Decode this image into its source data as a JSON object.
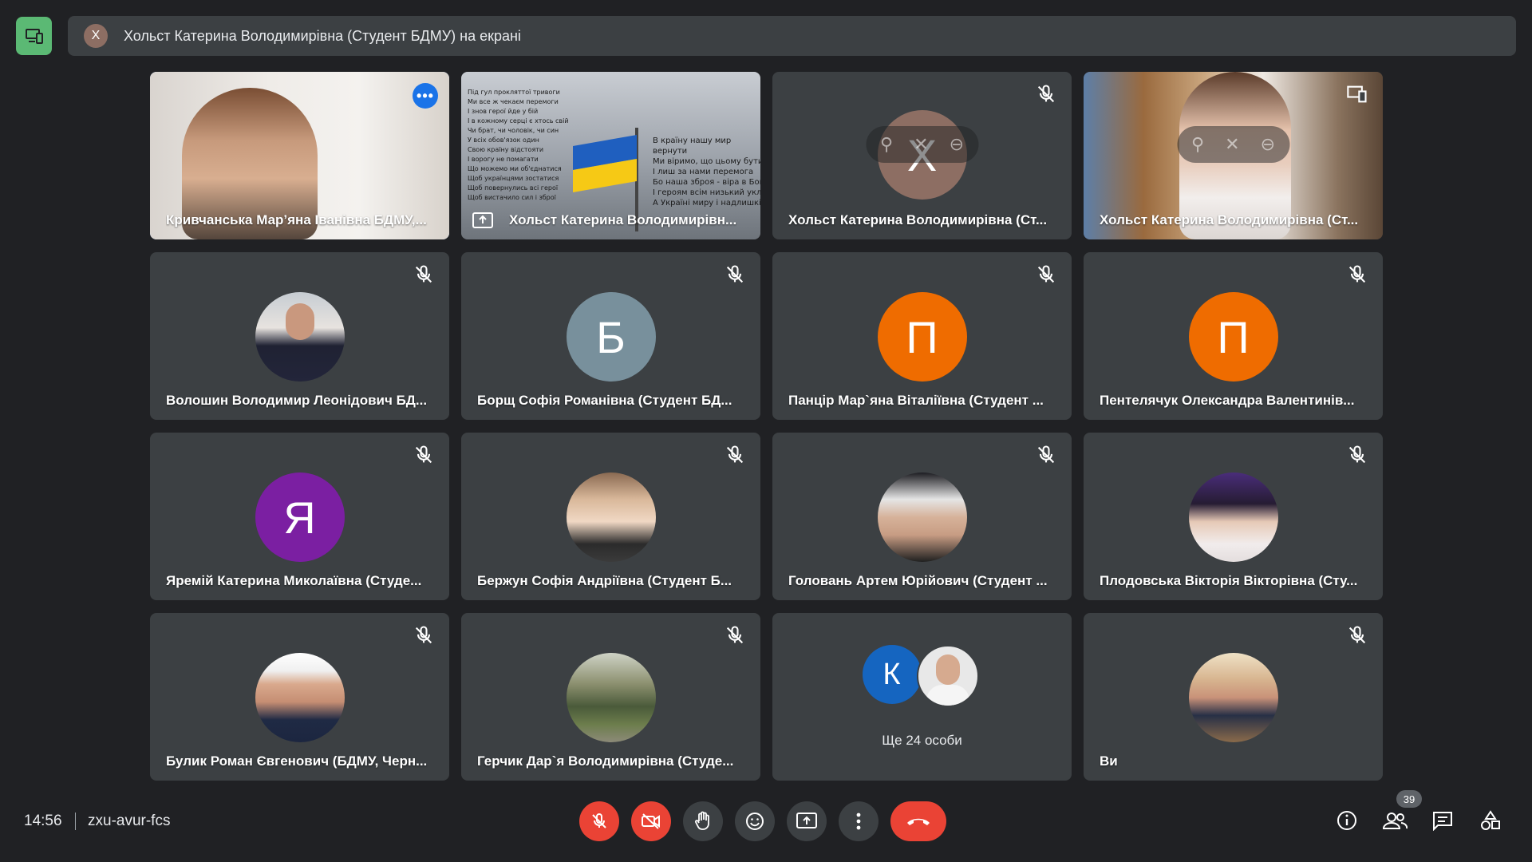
{
  "banner": {
    "avatar_letter": "Х",
    "text": "Хольст Катерина Володимирівна (Студент БДМУ) на екрані"
  },
  "tiles": [
    {
      "name": "Кривчанська Мар’яна Іванівна БДМУ,..."
    },
    {
      "name": "Хольст Катерина Володимирівн..."
    },
    {
      "name": "Хольст Катерина Володимирівна (Ст...",
      "avatar": "Х"
    },
    {
      "name": "Хольст Катерина Володимирівна (Ст..."
    },
    {
      "name": "Волошин Володимир Леонідович БД..."
    },
    {
      "name": "Борщ Софія Романівна (Студент БД...",
      "avatar": "Б"
    },
    {
      "name": "Панцір Мар`яна Віталіївна (Студент ...",
      "avatar": "П"
    },
    {
      "name": "Пентелячук Олександра Валентинів...",
      "avatar": "П"
    },
    {
      "name": "Яремій Катерина Миколаївна (Студе...",
      "avatar": "Я"
    },
    {
      "name": "Бержун Софія Андріївна (Студент Б..."
    },
    {
      "name": "Головань Артем Юрійович (Студент ..."
    },
    {
      "name": "Плодовська Вікторія Вікторівна (Сту..."
    },
    {
      "name": "Булик Роман Євгенович (БДМУ, Черн..."
    },
    {
      "name": "Герчик Дар`я Володимирівна (Студе..."
    },
    {
      "more_label": "Ще 24 особи",
      "avatar": "К"
    },
    {
      "name": "Ви"
    }
  ],
  "share_text": {
    "left": "Під гул прокляттої тривоги\nМи все ж чекаєм перемоги\nІ знов герої йде у бій\nІ в кожному серці є хтось свій\nЧи брат, чи чоловік, чи син\nУ всіх обов'язок один\nСвою країну відстояти\nІ ворогу не помагати\nЩо можемо ми об'єднатися\nЩоб українцями зостатися\nЩоб повернулись всі герої\nЩоб вистачило сил і зброї",
    "right": "В країну нашу мир\nвернути\nМи віримо, що цьому бути!\nІ лиш за нами перемога\nБо наша зброя - віра в Бога\nІ героям всім низький уклін\nА Україні миру і надлишків"
  },
  "colors": {
    "accent": "#8ab4f8",
    "orange": "#ef6c00",
    "purple": "#7b1fa2",
    "grey_blue": "#78909c",
    "red": "#ea4335",
    "green": "#5bb974"
  },
  "bottom": {
    "time": "14:56",
    "code": "zxu-avur-fcs",
    "participants_count": "39"
  }
}
